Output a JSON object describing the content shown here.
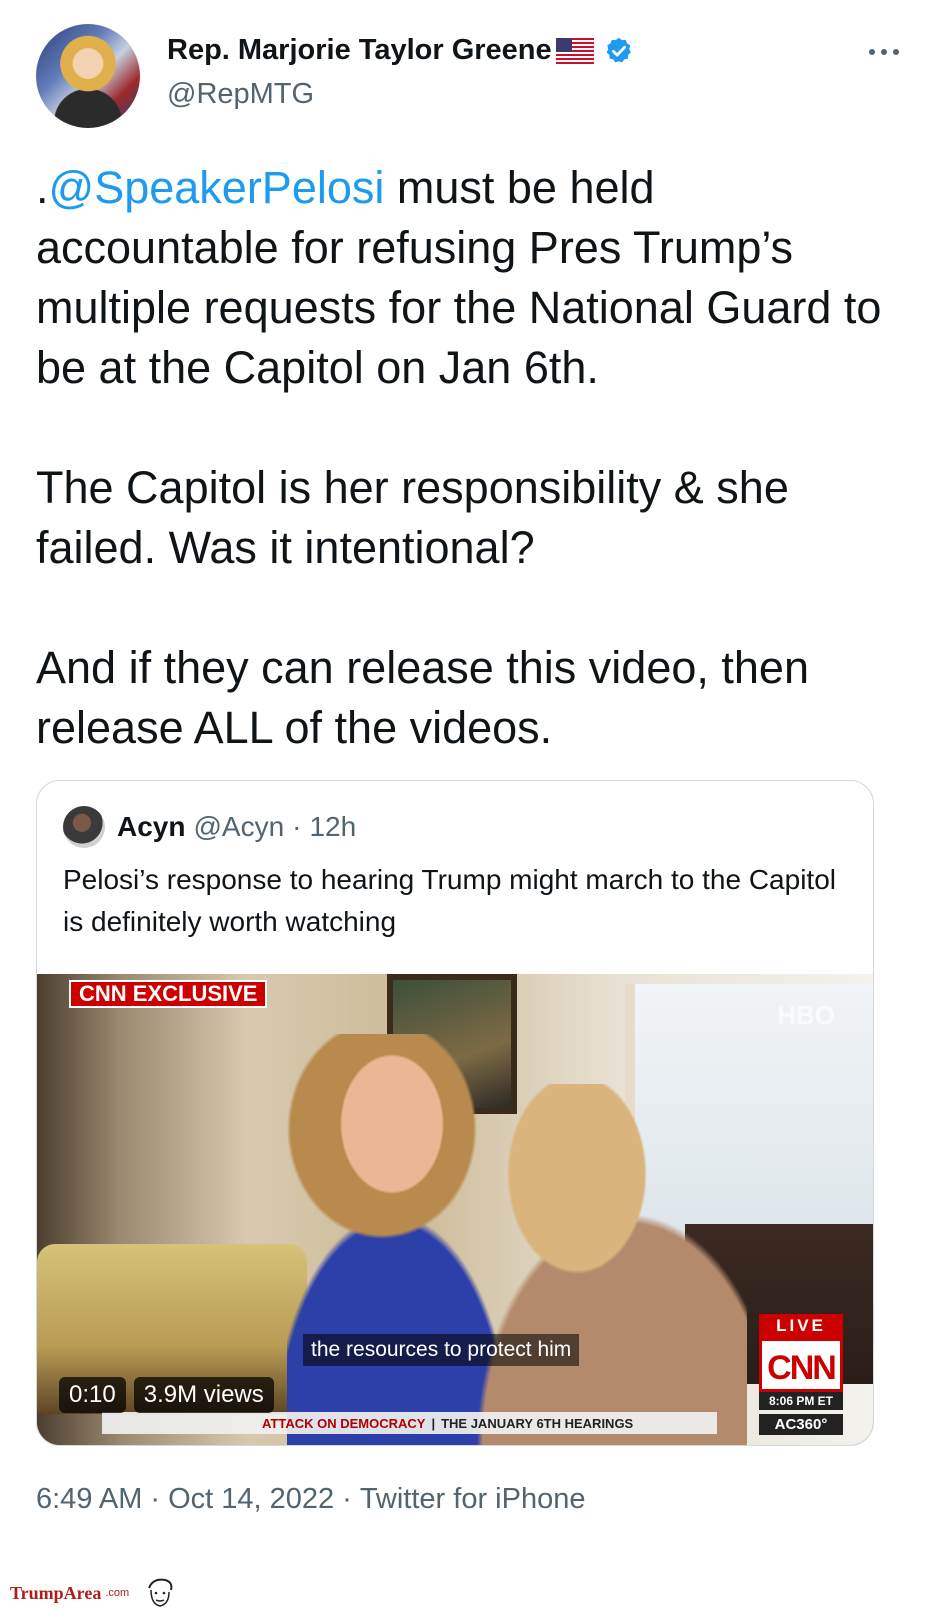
{
  "author": {
    "display_name": "Rep. Marjorie Taylor Greene",
    "handle": "@RepMTG",
    "flag_icon": "us-flag-icon",
    "verified_icon": "verified-badge-icon"
  },
  "tweet": {
    "mention": "@SpeakerPelosi",
    "prefix": ".",
    "para1_rest": " must be held accountable for refusing Pres Trump’s multiple requests for the National Guard to be at the Capitol on Jan 6th.",
    "para2": "The Capitol is her responsibility & she failed. Was it intentional?",
    "para3": "And if they can release this video, then release ALL of the videos."
  },
  "quote": {
    "name": "Acyn",
    "handle": "@Acyn",
    "dot": "·",
    "time": "12h",
    "text": "Pelosi’s response to hearing Trump might march to the Capitol is definitely worth watching"
  },
  "video": {
    "badge": "CNN EXCLUSIVE",
    "watermark": "HBO",
    "caption": "the resources to protect him",
    "ticker_red": "ATTACK ON DEMOCRACY",
    "ticker_sep": "|",
    "ticker_rest": "THE JANUARY 6TH HEARINGS",
    "live": "LIVE",
    "network": "CNN",
    "clock": "8:06 PM ET",
    "show": "AC360°",
    "duration": "0:10",
    "views": "3.9M views"
  },
  "meta": {
    "time": "6:49 AM",
    "sep1": "·",
    "date": "Oct 14, 2022",
    "sep2": "·",
    "source": "Twitter for iPhone"
  },
  "watermark": {
    "brand": "TrumpArea",
    "tld": ".com"
  },
  "colors": {
    "link": "#1d9bf0",
    "text": "#0f1419",
    "muted": "#536471",
    "border": "#cfd9de",
    "cnn_red": "#cc0000"
  }
}
